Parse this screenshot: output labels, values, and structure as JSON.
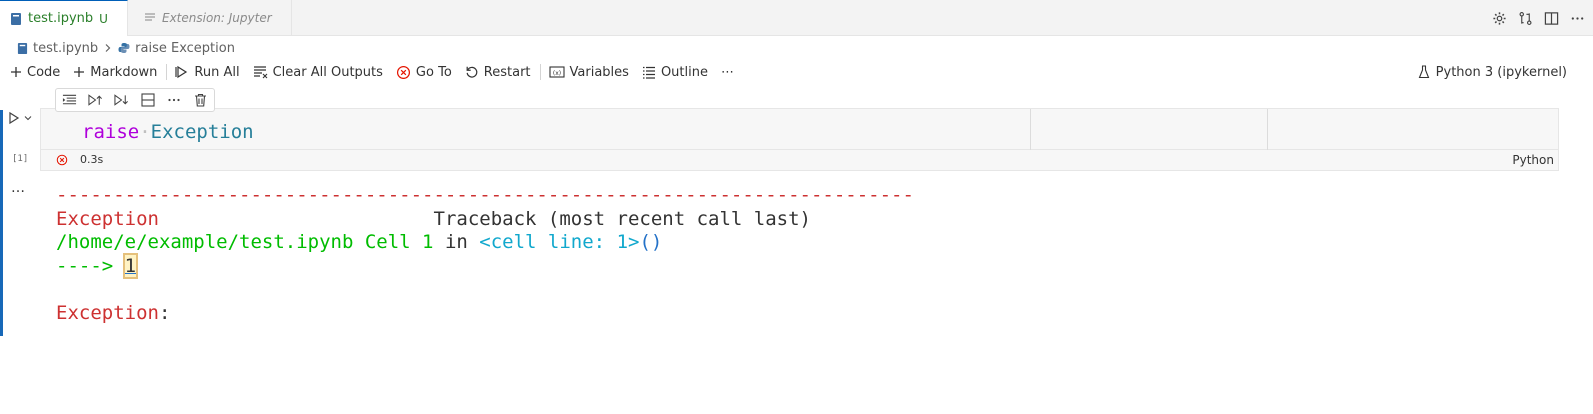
{
  "tabs": {
    "active": {
      "name": "test.ipynb",
      "status": "U"
    },
    "inactive": {
      "name": "Extension: Jupyter"
    }
  },
  "breadcrumbs": {
    "file": "test.ipynb",
    "symbol": "raise Exception"
  },
  "toolbar": {
    "code": "Code",
    "markdown": "Markdown",
    "run_all": "Run All",
    "clear_outputs": "Clear All Outputs",
    "go_to": "Go To",
    "restart": "Restart",
    "variables": "Variables",
    "outline": "Outline",
    "more": "⋯",
    "kernel": "Python 3 (ipykernel)"
  },
  "cell": {
    "code_keyword": "raise",
    "code_class": "Exception",
    "exec_count": "[1]",
    "duration": "0.3s",
    "language": "Python",
    "more": "…"
  },
  "output": {
    "dash_line": "---------------------------------------------------------------------------",
    "exc_name": "Exception",
    "traceback_header": "Traceback (most recent call last)",
    "path": "/home/e/example/test.ipynb Cell 1",
    "in_word": "in",
    "cell_line": "<cell line: 1>",
    "paren": "()",
    "arrow": "----> ",
    "line_no": "1",
    "final_name": "Exception",
    "final_colon": ":"
  },
  "colors": {
    "error_red": "#cd3131",
    "path_green": "#00bc00",
    "cyan": "#11a8cd",
    "keyword_purple": "#af00db",
    "class_teal": "#267f99",
    "focus_blue": "#1768b8"
  }
}
